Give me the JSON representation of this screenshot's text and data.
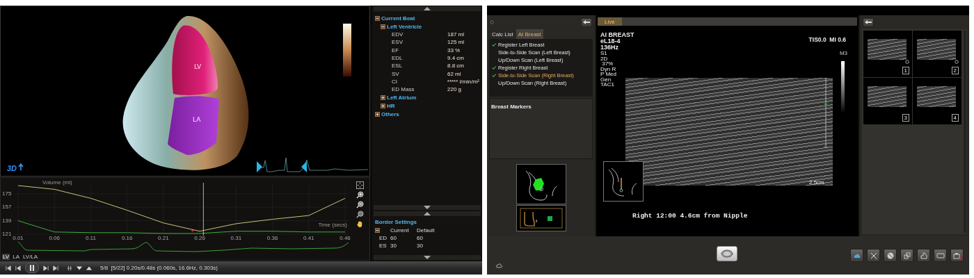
{
  "cardiac_view": {
    "labels": [
      "LV",
      "LA"
    ],
    "mode_badge": "3D"
  },
  "metrics_panel": {
    "tree": [
      {
        "label": "Current Beat",
        "expanded": true,
        "children": [
          {
            "label": "Left Ventricle",
            "expanded": true,
            "children": [
              {
                "label": "EDV",
                "value": "187 ml"
              },
              {
                "label": "ESV",
                "value": "125 ml"
              },
              {
                "label": "EF",
                "value": "33 %"
              },
              {
                "label": "EDL",
                "value": "9.4 cm"
              },
              {
                "label": "ESL",
                "value": "8.8 cm"
              },
              {
                "label": "SV",
                "value": "62 ml"
              },
              {
                "label": "CI",
                "value": "***** l/min/m²"
              },
              {
                "label": "ED Mass",
                "value": "220 g"
              }
            ]
          },
          {
            "label": "Left Atrium",
            "expanded": false
          },
          {
            "label": "HR",
            "expanded": false
          }
        ]
      },
      {
        "label": "Others",
        "expanded": false
      }
    ]
  },
  "border_settings": {
    "title": "Border Settings",
    "expanded": true,
    "columns": [
      "Current",
      "Default"
    ],
    "rows": [
      {
        "label": "ED",
        "current": "60",
        "default": "60"
      },
      {
        "label": "ES",
        "current": "30",
        "default": "30"
      }
    ]
  },
  "volume_chart": {
    "tabs": [
      {
        "label": "LV",
        "selected": true
      },
      {
        "label": "LA",
        "selected": false
      },
      {
        "label": "LV/LA",
        "selected": false
      }
    ],
    "chart_data": {
      "type": "line",
      "xlabel": "Time (secs)",
      "ylabel": "Volume (ml)",
      "x": [
        0.01,
        0.06,
        0.11,
        0.16,
        0.21,
        0.26,
        0.31,
        0.36,
        0.41,
        0.46
      ],
      "series": [
        {
          "color": "#c8c27a",
          "values": [
            186,
            181,
            169,
            153,
            136,
            125,
            135,
            141,
            146,
            169
          ]
        },
        {
          "color": "#3fae3f",
          "values": [
            139,
            124,
            123,
            123,
            122,
            122,
            125,
            125,
            124,
            124
          ]
        }
      ],
      "xticks": [
        0.01,
        0.06,
        0.11,
        0.16,
        0.21,
        0.26,
        0.31,
        0.36,
        0.41,
        0.46
      ],
      "yticks": [
        121,
        139,
        157,
        175
      ],
      "xlim": [
        0.01,
        0.46
      ],
      "ylim": [
        121,
        186
      ],
      "grid": true,
      "ref_lines": [
        {
          "axis": "x",
          "value": 0.265
        }
      ]
    }
  },
  "playback": {
    "status": "5/8  [5/22] 0.20s/0.48s (0.060s, 16.6Hz, 0.303s)"
  },
  "breast_app": {
    "side_panel": {
      "tabs": [
        {
          "label": "Calc List",
          "selected": false
        },
        {
          "label": "AI Breast",
          "selected": true
        }
      ],
      "checklist": [
        {
          "label": "Register Left Breast",
          "checked": true,
          "selected": false
        },
        {
          "label": "Side-to-Side Scan (Left Breast)",
          "checked": false,
          "selected": false
        },
        {
          "label": "Up/Down Scan (Left Breast)",
          "checked": false,
          "selected": false
        },
        {
          "label": "Register Right Breast",
          "checked": true,
          "selected": false
        },
        {
          "label": "Side-to-Side Scan (Right Breast)",
          "checked": true,
          "selected": true
        },
        {
          "label": "Up/Down Scan (Right Breast)",
          "checked": false,
          "selected": false
        }
      ],
      "markers_title": "Breast Markers"
    },
    "image_view": {
      "tab": "Live",
      "info": [
        {
          "text": "AI BREAST",
          "kind": "primary"
        },
        {
          "text": "eL18-4",
          "kind": "primary"
        },
        {
          "text": "136Hz",
          "kind": "primary"
        },
        {
          "text": "S1",
          "kind": "secondary"
        },
        {
          "text": "2D",
          "kind": "secondary"
        },
        {
          "text": " 37%",
          "kind": "secondary"
        },
        {
          "text": "Dyn R",
          "kind": "secondary"
        },
        {
          "text": "P Med",
          "kind": "secondary"
        },
        {
          "text": "Gen",
          "kind": "secondary"
        },
        {
          "text": "TAC1",
          "kind": "secondary"
        }
      ],
      "output": "TIS0.0  MI 0.6",
      "map": "M3",
      "depth": "2.5cm",
      "annotation": "Right 12:00 4.6cm from Nipple"
    },
    "thumbnails": [
      {
        "number": "1",
        "marked": true
      },
      {
        "number": "2",
        "marked": true
      },
      {
        "number": "3",
        "marked": false
      },
      {
        "number": "4",
        "marked": false
      }
    ]
  }
}
